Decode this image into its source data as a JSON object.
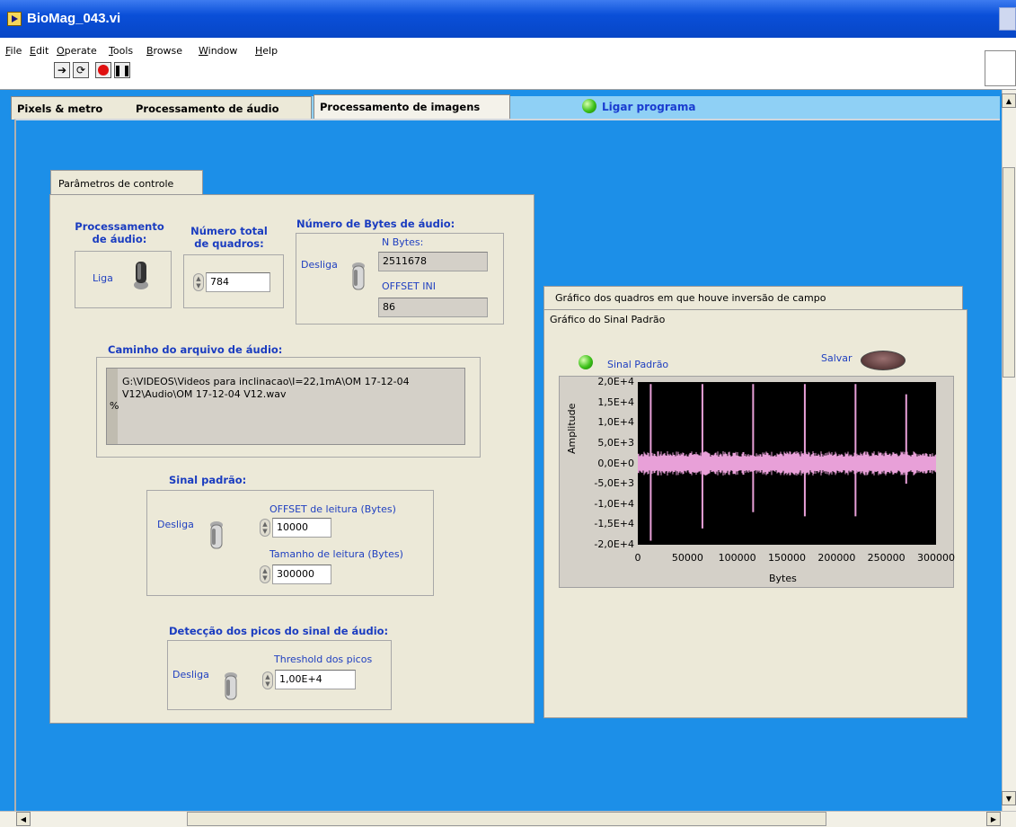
{
  "window": {
    "title": "BioMag_043.vi"
  },
  "menu": [
    "File",
    "Edit",
    "Operate",
    "Tools",
    "Browse",
    "Window",
    "Help"
  ],
  "tabs": [
    {
      "label": "Pixels & metro"
    },
    {
      "label": "Processamento de áudio"
    },
    {
      "label": "Processamento de imagens"
    }
  ],
  "ligar_programa": "Ligar programa",
  "control": {
    "tab_label": "Parâmetros de controle",
    "proc_audio": {
      "label": "Processamento de áudio:",
      "state": "Liga"
    },
    "num_quadros": {
      "label": "Número total de quadros:",
      "value": "784"
    },
    "num_bytes": {
      "label": "Número de Bytes de áudio:",
      "state": "Desliga",
      "n_bytes_label": "N Bytes:",
      "n_bytes_value": "2511678",
      "offset_label": "OFFSET INI",
      "offset_value": "86"
    },
    "caminho": {
      "label": "Caminho do arquivo de áudio:",
      "value_line1": "G:\\VIDEOS\\Videos para inclinacao\\I=22,1mA\\OM 17-12-04",
      "value_line2": "V12\\Audio\\OM 17-12-04 V12.wav",
      "marker": "%"
    },
    "sinal_padrao": {
      "label": "Sinal padrão:",
      "state": "Desliga",
      "offset_label": "OFFSET de leitura (Bytes)",
      "offset_value": "10000",
      "tamanho_label": "Tamanho de leitura (Bytes)",
      "tamanho_value": "300000"
    },
    "deteccao": {
      "label": "Detecção dos picos do sinal de áudio:",
      "state": "Desliga",
      "threshold_label": "Threshold dos picos",
      "threshold_value": "1,00E+4"
    }
  },
  "graph": {
    "tab_label": "Gráfico dos quadros em que houve inversão de campo",
    "subtitle": "Gráfico do Sinal Padrão",
    "led_label": "Sinal Padrão",
    "salvar_label": "Salvar"
  },
  "chart_data": {
    "type": "line",
    "xlabel": "Bytes",
    "ylabel": "Amplitude",
    "xlim": [
      0,
      300000
    ],
    "ylim": [
      -20000,
      20000
    ],
    "x_ticks": [
      "0",
      "50000",
      "100000",
      "150000",
      "200000",
      "250000",
      "300000"
    ],
    "y_ticks": [
      "2,0E+4",
      "1,5E+4",
      "1,0E+4",
      "5,0E+3",
      "0,0E+0",
      "-5,0E+3",
      "-1,0E+4",
      "-1,5E+4",
      "-2,0E+4"
    ],
    "series_color": "#e8a0d8",
    "background": "#000000",
    "band_amplitude": 3000,
    "peaks": [
      {
        "x": 13000,
        "high": 19500,
        "low": -19000
      },
      {
        "x": 65000,
        "high": 19500,
        "low": -16000
      },
      {
        "x": 116000,
        "high": 19500,
        "low": -12000
      },
      {
        "x": 168000,
        "high": 19500,
        "low": -13000
      },
      {
        "x": 219000,
        "high": 19500,
        "low": -13000
      },
      {
        "x": 270000,
        "high": 17000,
        "low": -5000
      }
    ]
  }
}
